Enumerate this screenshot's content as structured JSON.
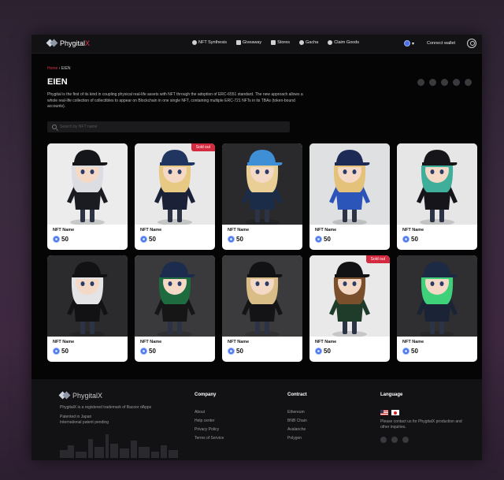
{
  "header": {
    "logo_main": "Phygital",
    "logo_accent": "X",
    "nav": [
      {
        "label": "NFT Synthesis",
        "icon": "gear-icon"
      },
      {
        "label": "Giveaway",
        "icon": "gift-icon"
      },
      {
        "label": "Stores",
        "icon": "store-icon"
      },
      {
        "label": "Gacha",
        "icon": "capsule-icon"
      },
      {
        "label": "Claim Goods",
        "icon": "hand-icon"
      }
    ],
    "network_caret": "▾",
    "connect_label": "Connect wallet"
  },
  "page": {
    "breadcrumb_home": "Home",
    "breadcrumb_sep": "›",
    "breadcrumb_current": "EIEN",
    "title": "EIEN",
    "description": "Phygital is the first of its kind in coupling physical real-life assets with NFT through the adoption of ERC-6551 standard. The new approach allows a whole real-life collection of collectibles to appear on Blockchain in one single NFT, containing multiple ERC-721 NFTs in its TBAs (token-bound accounts).",
    "search_placeholder": "Search by NFT name"
  },
  "cards": [
    {
      "name": "NFT Name",
      "price": "50",
      "sold_out": "",
      "bg": "#ececec",
      "hair": "#dcdde3",
      "cap": "#15161a",
      "outfit": "#1a1c22"
    },
    {
      "name": "NFT Name",
      "price": "50",
      "sold_out": "Sold out",
      "bg": "#e8e8e8",
      "hair": "#e8c983",
      "cap": "#20355f",
      "outfit": "#1b2238"
    },
    {
      "name": "NFT Name",
      "price": "50",
      "sold_out": "",
      "bg": "#2a2a2c",
      "hair": "#e9cf96",
      "cap": "#3f8fd6",
      "outfit": "#1b2c48"
    },
    {
      "name": "NFT Name",
      "price": "50",
      "sold_out": "",
      "bg": "#dfe0e2",
      "hair": "#e5c27a",
      "cap": "#1c2a55",
      "outfit": "#2b55b8"
    },
    {
      "name": "NFT Name",
      "price": "50",
      "sold_out": "",
      "bg": "#e6e6e6",
      "hair": "#3fae9a",
      "cap": "#16161a",
      "outfit": "#16161a"
    },
    {
      "name": "NFT Name",
      "price": "50",
      "sold_out": "",
      "bg": "#2b2b2d",
      "hair": "#e4e4e6",
      "cap": "#121214",
      "outfit": "#121214"
    },
    {
      "name": "NFT Name",
      "price": "50",
      "sold_out": "",
      "bg": "#3a3a3c",
      "hair": "#1d6b3f",
      "cap": "#1c2c4e",
      "outfit": "#161616"
    },
    {
      "name": "NFT Name",
      "price": "50",
      "sold_out": "",
      "bg": "#3b3b3d",
      "hair": "#d9bd86",
      "cap": "#121214",
      "outfit": "#141416"
    },
    {
      "name": "NFT Name",
      "price": "50",
      "sold_out": "Sold out",
      "bg": "#e9e9e9",
      "hair": "#7a4f2c",
      "cap": "#121214",
      "outfit": "#1f3b2a"
    },
    {
      "name": "NFT Name",
      "price": "50",
      "sold_out": "",
      "bg": "#2f2f31",
      "hair": "#3fd07a",
      "cap": "#1c2a44",
      "outfit": "#1a2436"
    }
  ],
  "footer": {
    "logo": "PhygitalX",
    "tagline": "PhygitalX is a registered trademark of Bacoor dApps",
    "patent_1": "Patented in Japan",
    "patent_2": "International patent pending",
    "company": {
      "heading": "Company",
      "links": [
        "About",
        "Help center",
        "Privacy Policy",
        "Terms of Service"
      ]
    },
    "contract": {
      "heading": "Contract",
      "links": [
        "Ethereum",
        "BNB Chain",
        "Avalanche",
        "Polygon"
      ]
    },
    "language": {
      "heading": "Language",
      "note": "Please contact us for PhygitalX production and other inquiries."
    }
  },
  "colors": {
    "accent": "#d42a3f",
    "coin": "#4f77e8",
    "panel": "#050505"
  }
}
